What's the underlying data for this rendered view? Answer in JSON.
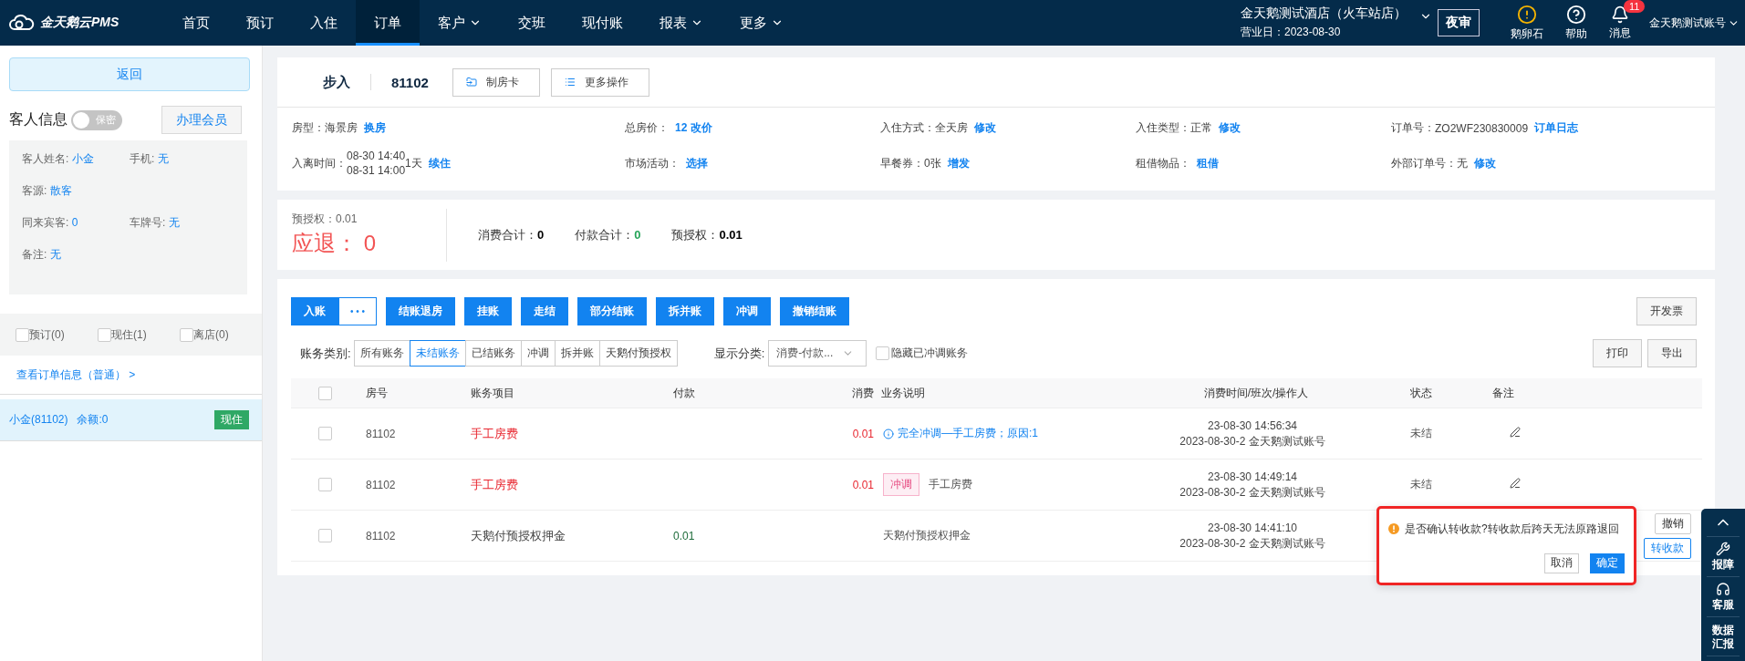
{
  "nav": {
    "brand": "金天鹅云PMS",
    "items": [
      {
        "label": "首页",
        "selected": false,
        "dropdown": false
      },
      {
        "label": "预订",
        "selected": false,
        "dropdown": false
      },
      {
        "label": "入住",
        "selected": false,
        "dropdown": false
      },
      {
        "label": "订单",
        "selected": true,
        "dropdown": false
      },
      {
        "label": "客户",
        "selected": false,
        "dropdown": true
      },
      {
        "label": "交班",
        "selected": false,
        "dropdown": false
      },
      {
        "label": "现付账",
        "selected": false,
        "dropdown": false
      },
      {
        "label": "报表",
        "selected": false,
        "dropdown": true
      },
      {
        "label": "更多",
        "selected": false,
        "dropdown": true
      }
    ],
    "hotel": {
      "name": "金天鹅测试酒店（火车站店）",
      "business_date": "营业日：2023-08-30"
    },
    "night_audit": "夜审",
    "tools": [
      {
        "kind": "warning",
        "label": "鹅卵石"
      },
      {
        "kind": "help",
        "label": "帮助"
      },
      {
        "kind": "bell",
        "label": "消息",
        "badge": "11"
      }
    ],
    "account": "金天鹅测试账号"
  },
  "left": {
    "back_button": "返回",
    "title": "客人信息",
    "privacy": {
      "label": "保密",
      "on": false
    },
    "member_button": "办理会员",
    "guest_fields": [
      [
        {
          "label": "客人姓名:",
          "value": "小金"
        },
        {
          "label": "手机:",
          "value": "无"
        }
      ],
      [
        {
          "label": "客源:",
          "value": "散客"
        }
      ],
      [
        {
          "label": "同来宾客:",
          "value": "0"
        },
        {
          "label": "车牌号:",
          "value": "无"
        }
      ],
      [
        {
          "label": "备注:",
          "value": "无"
        }
      ]
    ],
    "filters": [
      {
        "label": "预订(0)",
        "checked": false
      },
      {
        "label": "现住(1)",
        "checked": false
      },
      {
        "label": "离店(0)",
        "checked": false
      }
    ],
    "order_link": "查看订单信息（普通） >",
    "guests": [
      {
        "name": "小金(81102)",
        "balance": "余额:0",
        "status": "现住",
        "selected": true
      }
    ]
  },
  "order": {
    "type": "步入",
    "room": "81102",
    "buttons": [
      {
        "kind": "card",
        "label": "制房卡"
      },
      {
        "kind": "list",
        "label": "更多操作"
      }
    ],
    "info": [
      [
        {
          "label": "房型：",
          "value": "海景房",
          "action": "换房"
        },
        {
          "label": "总房价：",
          "action": "12 改价"
        },
        {
          "label": "入住方式：",
          "value": "全天房",
          "action": "修改"
        },
        {
          "label": "入住类型：",
          "value": "正常",
          "action": "修改"
        },
        {
          "label": "订单号：",
          "value": "ZO2WF230830009",
          "action": "订单日志"
        }
      ],
      [
        {
          "label": "入离时间：",
          "lines": [
            "08-30 14:40",
            "08-31 14:00"
          ],
          "value": "1天",
          "action": "续住"
        },
        {
          "label": "市场活动：",
          "action": "选择"
        },
        {
          "label": "早餐券：",
          "value": "0张",
          "action": "增发"
        },
        {
          "label": "租借物品：",
          "action": "租借"
        },
        {
          "label": "外部订单号：",
          "value": "无",
          "action": "修改"
        }
      ]
    ]
  },
  "summary": {
    "preauth": "预授权：0.01",
    "refund_label": "应退：",
    "refund": "0",
    "totals": [
      {
        "label": "消费合计：",
        "value": "0",
        "color": "#000000"
      },
      {
        "label": "付款合计：",
        "value": "0",
        "color": "#27a55a"
      },
      {
        "label": "预授权：",
        "value": "0.01",
        "color": "#000000"
      }
    ]
  },
  "toolbar": {
    "main": "入账",
    "more": "• • •",
    "buttons": [
      "结账退房",
      "挂账",
      "走结",
      "部分结账",
      "拆并账",
      "冲调",
      "撤销结账"
    ],
    "invoice": "开发票"
  },
  "filter_bar": {
    "label": "账务类别:",
    "segments": [
      {
        "label": "所有账务",
        "selected": false
      },
      {
        "label": "未结账务",
        "selected": true
      },
      {
        "label": "已结账务",
        "selected": false
      },
      {
        "label": "冲调",
        "selected": false
      },
      {
        "label": "拆并账",
        "selected": false
      },
      {
        "label": "天鹅付预授权",
        "selected": false
      }
    ],
    "display_label": "显示分类:",
    "display_value": "消费-付款...",
    "hide": {
      "label": "隐藏已冲调账务",
      "checked": false
    },
    "buttons": [
      "打印",
      "导出"
    ]
  },
  "table": {
    "select_all": false,
    "columns": [
      "房号",
      "账务项目",
      "付款",
      "消费",
      "业务说明",
      "消费时间/班次/操作人",
      "状态",
      "备注"
    ],
    "rows": [
      {
        "checked": false,
        "room": "81102",
        "item": "手工房费",
        "color": "#e8262f",
        "payment": "",
        "consume": "0.01",
        "desc": {
          "kind": "info",
          "text": "完全冲调—手工房费；原因:1"
        },
        "time": "23-08-30 14:56:34",
        "shift": "2023-08-30-2 金天鹅测试账号",
        "status": "未结",
        "edit": true
      },
      {
        "checked": false,
        "room": "81102",
        "item": "手工房费",
        "color": "#e8262f",
        "payment": "",
        "consume": "0.01",
        "desc": {
          "kind": "tag",
          "tag": "冲调",
          "text": "手工房费"
        },
        "time": "23-08-30 14:49:14",
        "shift": "2023-08-30-2 金天鹅测试账号",
        "status": "未结",
        "edit": true
      },
      {
        "checked": false,
        "room": "81102",
        "item": "天鹅付预授权押金",
        "color": "#444444",
        "payment": "0.01",
        "consume": "",
        "desc": {
          "kind": "plain",
          "text": "天鹅付预授权押金"
        },
        "time": "23-08-30 14:41:10",
        "shift": "2023-08-30-2 金天鹅测试账号",
        "status": "",
        "edit": false,
        "actions": [
          {
            "label": "撤销",
            "selected": false
          },
          {
            "label": "转收款",
            "selected": true
          }
        ],
        "confirm": {
          "message": "是否确认转收款?转收款后跨天无法原路退回",
          "cancel": "取消",
          "ok": "确定"
        }
      }
    ]
  },
  "float_bar": [
    {
      "kind": "up"
    },
    {
      "kind": "wrench",
      "label": "报障"
    },
    {
      "kind": "headset",
      "label": "客服"
    },
    {
      "kind": "text",
      "label": "数据汇报"
    }
  ]
}
